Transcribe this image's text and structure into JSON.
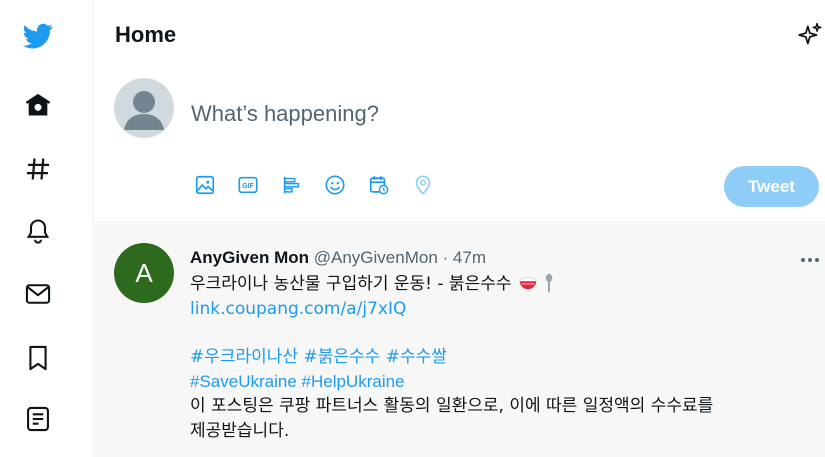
{
  "header": {
    "title": "Home"
  },
  "composer": {
    "placeholder": "What’s happening?",
    "tweet_button": "Tweet"
  },
  "tweet": {
    "avatar_letter": "A",
    "author_name": "AnyGiven Mon",
    "handle": "@AnyGivenMon",
    "separator": "·",
    "time": "47m",
    "line1": "우크라이나 농산물 구입하기 운동! - 붉은수수",
    "link": "link.coupang.com/a/j7xIQ",
    "hashtags_ko": [
      "#우크라이나산",
      "#붉은수수",
      "#수수쌀"
    ],
    "hashtags_en": [
      "#SaveUkraine",
      "#HelpUkraine"
    ],
    "line_disclosure_1": "이 포스팅은 쿠팡 파트너스 활동의 일환으로, 이에 따른 일정액의 수수료를",
    "line_disclosure_2": "제공받습니다."
  },
  "icons": {
    "sidebar": [
      "twitter-bird-icon",
      "home-icon",
      "explore-hashtag-icon",
      "notifications-bell-icon",
      "messages-envelope-icon",
      "bookmarks-icon",
      "lists-icon"
    ],
    "composer_tools": [
      "image-icon",
      "gif-icon",
      "poll-icon",
      "emoji-icon",
      "schedule-icon",
      "location-icon"
    ],
    "tweet_emoji": [
      "rice-bowl-emoji",
      "spoon-emoji"
    ]
  },
  "colors": {
    "brand": "#1d9bf0",
    "tweet_button_disabled": "#8ecdf8",
    "avatar_green": "#2e6a1e",
    "text_muted": "#536471"
  }
}
